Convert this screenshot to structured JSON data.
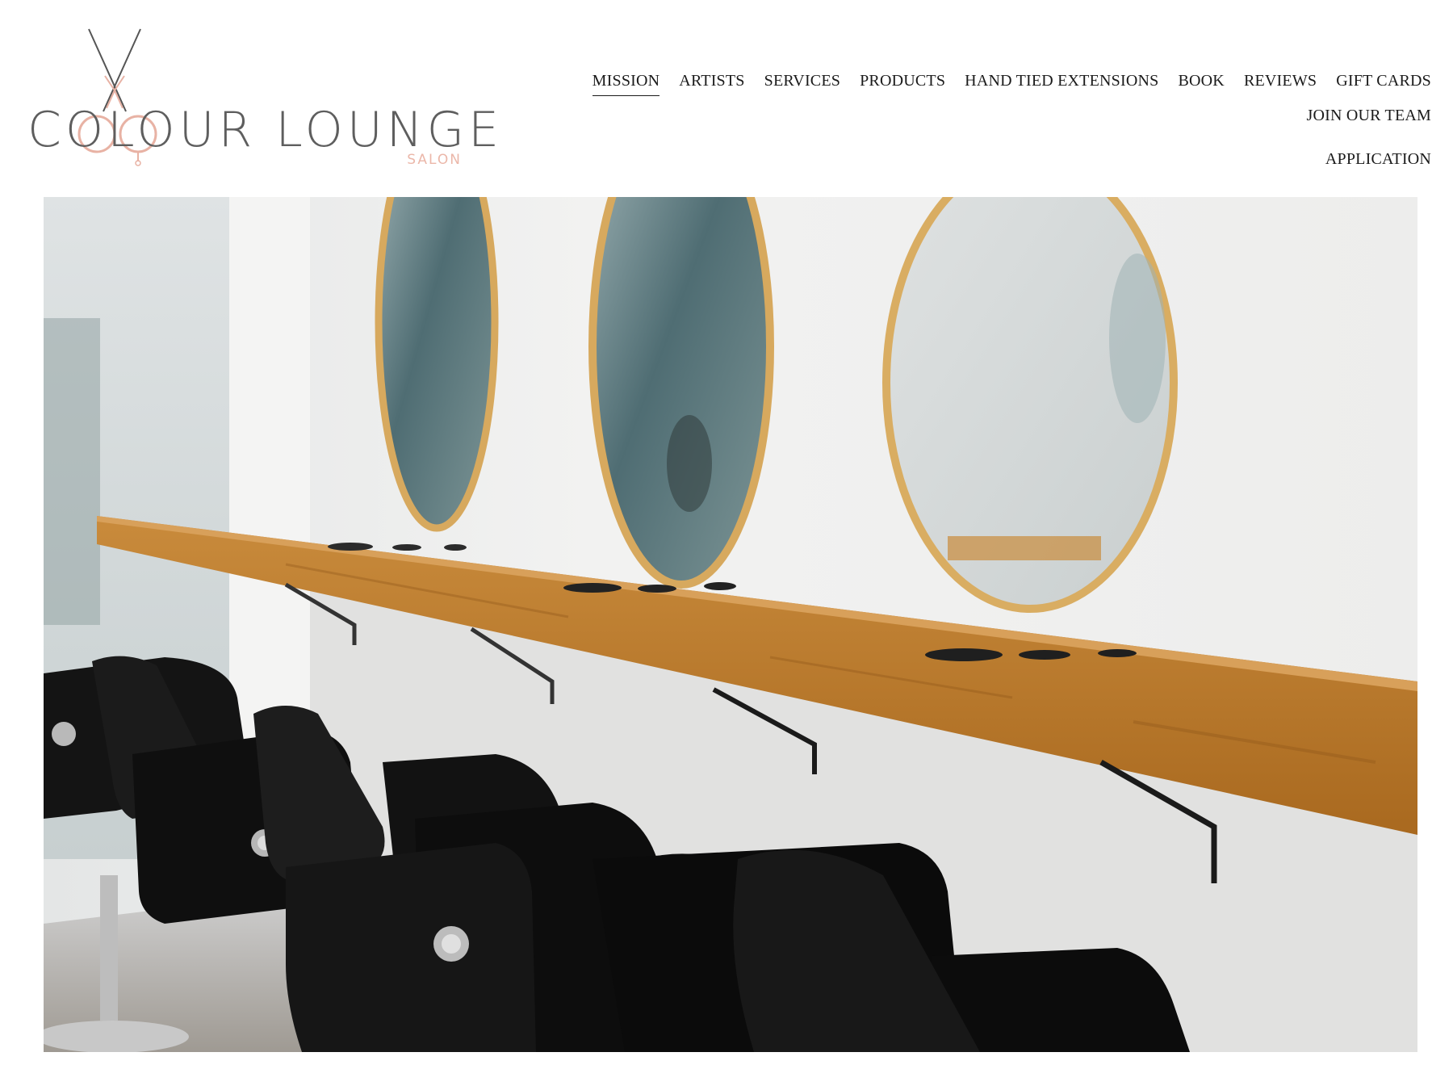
{
  "logo": {
    "name": "COLOUR LOUNGE",
    "subtitle": "SALON",
    "colors": {
      "text": "#5e5e5e",
      "accent": "#ebb7a9"
    }
  },
  "nav": {
    "items": [
      {
        "label": "MISSION",
        "active": true
      },
      {
        "label": "ARTISTS",
        "active": false
      },
      {
        "label": "SERVICES",
        "active": false
      },
      {
        "label": "PRODUCTS",
        "active": false
      },
      {
        "label": "HAND TIED EXTENSIONS",
        "active": false
      },
      {
        "label": "BOOK",
        "active": false
      },
      {
        "label": "REVIEWS",
        "active": false
      },
      {
        "label": "GIFT CARDS",
        "active": false
      },
      {
        "label": "JOIN OUR TEAM",
        "active": false
      },
      {
        "label": "APPLICATION",
        "active": false
      }
    ]
  },
  "hero": {
    "image": "salon-interior-photo"
  }
}
